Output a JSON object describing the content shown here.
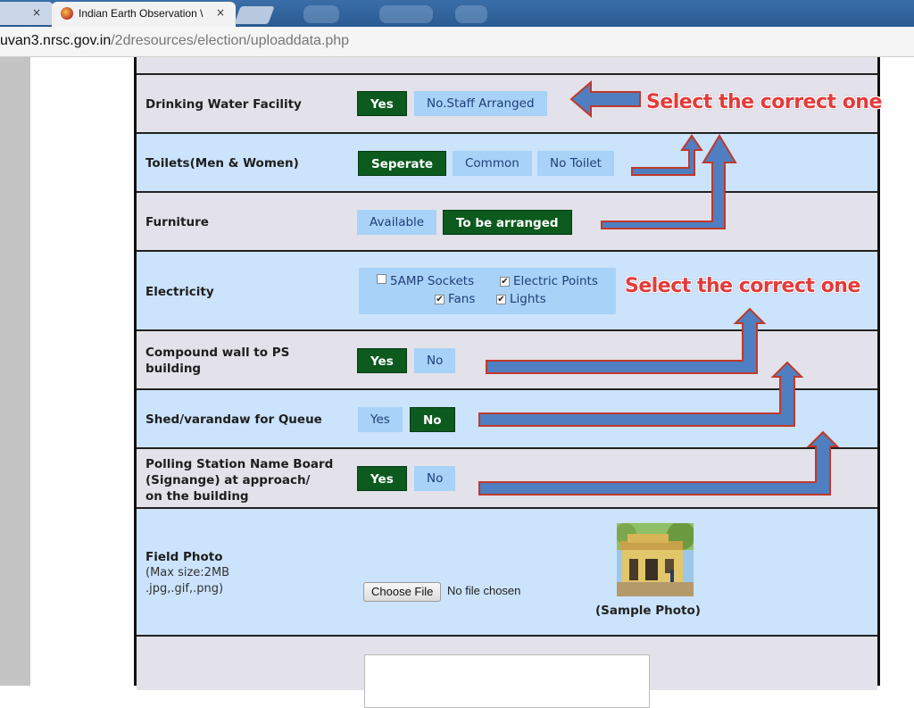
{
  "browser": {
    "prev_tab_close": "×",
    "active_tab_title": "Indian Earth Observation \\",
    "active_tab_close": "×",
    "url_host": "uvan3.nrsc.gov.in",
    "url_path": "/2dresources/election/uploaddata.php"
  },
  "form": {
    "drinking_water": {
      "label": "Drinking Water Facility",
      "options": [
        "Yes",
        "No.Staff Arranged"
      ],
      "selected": "Yes"
    },
    "toilets": {
      "label": "Toilets(Men   & Women)",
      "options": [
        "Seperate",
        "Common",
        "No Toilet"
      ],
      "selected": "Seperate"
    },
    "furniture": {
      "label": "Furniture",
      "options": [
        "Available",
        "To be arranged"
      ],
      "selected": "To be arranged"
    },
    "electricity": {
      "label": "Electricity",
      "checkboxes": [
        {
          "label": "5AMP Sockets",
          "checked": false
        },
        {
          "label": "Electric Points",
          "checked": true
        },
        {
          "label": "Fans",
          "checked": true
        },
        {
          "label": "Lights",
          "checked": true
        }
      ],
      "check_mark": "✔"
    },
    "compound_wall": {
      "label_line1": "Compound wall to PS",
      "label_line2": "building",
      "options": [
        "Yes",
        "No"
      ],
      "selected": "Yes"
    },
    "shed": {
      "label": "Shed/varandaw for Queue",
      "options": [
        "Yes",
        "No"
      ],
      "selected": "No"
    },
    "name_board": {
      "label_line1": "Polling Station Name Board",
      "label_line2": " (Signange) at approach/",
      "label_line3": "on the building",
      "options": [
        "Yes",
        "No"
      ],
      "selected": "Yes"
    },
    "field_photo": {
      "label": "Field Photo",
      "note_line1": "(Max size:2MB",
      "note_line2": " .jpg,.gif,.png)",
      "choose_button": "Choose File",
      "no_file_text": "No file chosen",
      "sample_caption": "(Sample Photo)"
    }
  },
  "annotations": {
    "text_top": "Select the correct one",
    "text_mid": "Select the correct one",
    "arrow_fill": "#4f7fc0",
    "arrow_stroke": "#c0392b",
    "text_color": "#e23b3b"
  },
  "colors": {
    "selected_button": "#0c5a1e",
    "unselected_button": "#a8d2f7",
    "row_gray": "#e3e1ea",
    "row_blue": "#cbe3fb"
  }
}
